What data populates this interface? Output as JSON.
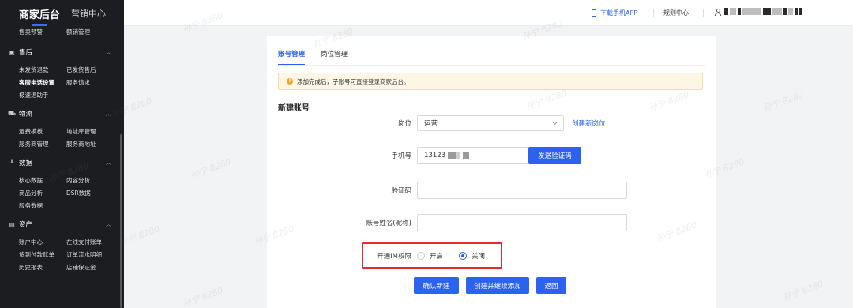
{
  "sidebar": {
    "brand": "商家后台",
    "tab2": "营销中心",
    "top_items": [
      "售卖预警",
      "额销管理"
    ],
    "sections": [
      {
        "title": "售后",
        "icon": "box-icon",
        "items": [
          "未发货退款",
          "已发货售后",
          "客服电话设置",
          "服务请求",
          "极速退助手"
        ],
        "active": "客服电话设置"
      },
      {
        "title": "物流",
        "icon": "truck-icon",
        "items": [
          "运费模板",
          "地址库管理",
          "服务商管理",
          "服务商地址"
        ]
      },
      {
        "title": "数据",
        "icon": "chart-icon",
        "items": [
          "核心数据",
          "内容分析",
          "商品分析",
          "DSR数据",
          "服务数据"
        ]
      },
      {
        "title": "资产",
        "icon": "wallet-icon",
        "items": [
          "账户中心",
          "在线支付账单",
          "货到付款账单",
          "订单流水明细",
          "历史报表",
          "店铺保证金"
        ]
      }
    ]
  },
  "header": {
    "download_app": "下载手机APP",
    "rules_center": "规则中心"
  },
  "tabs": [
    {
      "label": "账号管理",
      "active": true
    },
    {
      "label": "岗位管理",
      "active": false
    }
  ],
  "notice": "添加完成后，子账号可直接登录商家后台。",
  "form": {
    "title": "新建账号",
    "position_label": "岗位",
    "position_value": "运营",
    "create_position_link": "创建新岗位",
    "phone_label": "手机号",
    "phone_value": "13123",
    "send_code_button": "发送验证码",
    "code_label": "验证码",
    "name_label": "账号姓名(昵称)",
    "im_label": "开通IM权限",
    "im_on": "开启",
    "im_off": "关闭",
    "im_selected": "关闭"
  },
  "actions": {
    "confirm": "确认新建",
    "create_continue": "创建并继续添加",
    "back": "返回"
  },
  "watermark": "孙宁 8280",
  "colors": {
    "accent": "#2b62f0",
    "sidebar_bg": "#1c1d21",
    "highlight_border": "#e02d2d",
    "notice_bg": "#fdf6e4"
  }
}
